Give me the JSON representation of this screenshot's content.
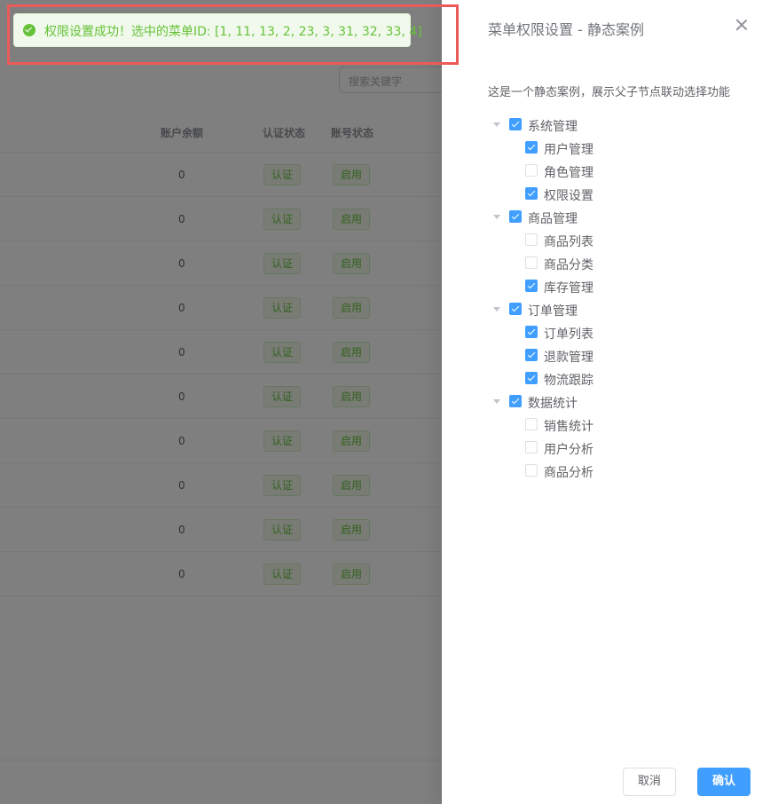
{
  "background": {
    "search_placeholder": "搜索关键字",
    "columns": {
      "balance": "账户余额",
      "cert": "认证状态",
      "acct": "账号状态"
    },
    "rows": [
      {
        "balance": "0",
        "cert": "认证",
        "acct": "启用"
      },
      {
        "balance": "0",
        "cert": "认证",
        "acct": "启用"
      },
      {
        "balance": "0",
        "cert": "认证",
        "acct": "启用"
      },
      {
        "balance": "0",
        "cert": "认证",
        "acct": "启用"
      },
      {
        "balance": "0",
        "cert": "认证",
        "acct": "启用"
      },
      {
        "balance": "0",
        "cert": "认证",
        "acct": "启用"
      },
      {
        "balance": "0",
        "cert": "认证",
        "acct": "启用"
      },
      {
        "balance": "0",
        "cert": "认证",
        "acct": "启用"
      },
      {
        "balance": "0",
        "cert": "认证",
        "acct": "启用"
      },
      {
        "balance": "0",
        "cert": "认证",
        "acct": "启用"
      }
    ]
  },
  "toast": {
    "icon": "success-check-icon",
    "message": "权限设置成功！选中的菜单ID: [1, 11, 13, 2, 23, 3, 31, 32, 33, 4]"
  },
  "drawer": {
    "title": "菜单权限设置 - 静态案例",
    "description": "这是一个静态案例，展示父子节点联动选择功能",
    "tree": [
      {
        "label": "系统管理",
        "checked": true,
        "children": [
          {
            "label": "用户管理",
            "checked": true
          },
          {
            "label": "角色管理",
            "checked": false
          },
          {
            "label": "权限设置",
            "checked": true
          }
        ]
      },
      {
        "label": "商品管理",
        "checked": true,
        "children": [
          {
            "label": "商品列表",
            "checked": false
          },
          {
            "label": "商品分类",
            "checked": false
          },
          {
            "label": "库存管理",
            "checked": true
          }
        ]
      },
      {
        "label": "订单管理",
        "checked": true,
        "children": [
          {
            "label": "订单列表",
            "checked": true
          },
          {
            "label": "退款管理",
            "checked": true
          },
          {
            "label": "物流跟踪",
            "checked": true
          }
        ]
      },
      {
        "label": "数据统计",
        "checked": true,
        "children": [
          {
            "label": "销售统计",
            "checked": false
          },
          {
            "label": "用户分析",
            "checked": false
          },
          {
            "label": "商品分析",
            "checked": false
          }
        ]
      }
    ],
    "cancel_label": "取消",
    "confirm_label": "确认"
  },
  "colors": {
    "primary": "#409eff",
    "success": "#67c23a",
    "highlight": "#ec5a5a"
  }
}
